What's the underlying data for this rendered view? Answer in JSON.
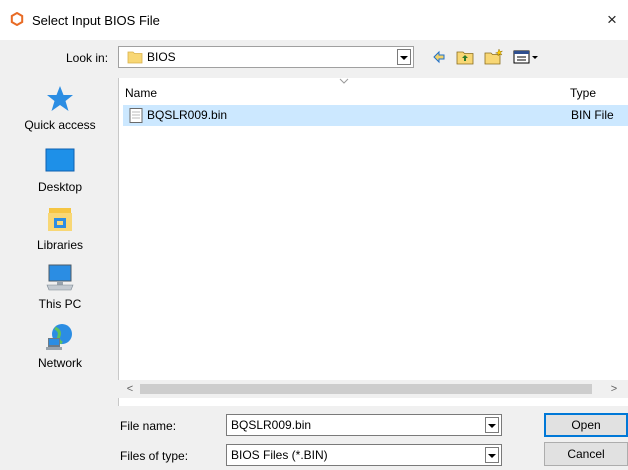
{
  "window": {
    "title": "Select Input BIOS File",
    "close_glyph": "×",
    "icon": "app-ring-icon"
  },
  "lookin": {
    "label": "Look in:",
    "value": "BIOS"
  },
  "toolbar": {
    "icons": [
      "back-arrow-icon",
      "up-folder-icon",
      "new-folder-icon",
      "view-menu-icon"
    ]
  },
  "places": [
    {
      "label": "Quick access",
      "icon": "star-icon"
    },
    {
      "label": "Desktop",
      "icon": "desktop-icon"
    },
    {
      "label": "Libraries",
      "icon": "libraries-icon"
    },
    {
      "label": "This PC",
      "icon": "computer-icon"
    },
    {
      "label": "Network",
      "icon": "network-icon"
    }
  ],
  "filelist": {
    "columns": [
      "Name",
      "Type"
    ],
    "rows": [
      {
        "name": "BQSLR009.bin",
        "type": "BIN File"
      }
    ]
  },
  "fields": {
    "filename_label": "File name:",
    "filename_value": "BQSLR009.bin",
    "filetype_label": "Files of type:",
    "filetype_value": "BIOS Files (*.BIN)"
  },
  "buttons": {
    "open": "Open",
    "cancel": "Cancel"
  },
  "colors": {
    "accent": "#0078d7",
    "selection": "#cce8ff",
    "icon_orange": "#e86b25"
  }
}
